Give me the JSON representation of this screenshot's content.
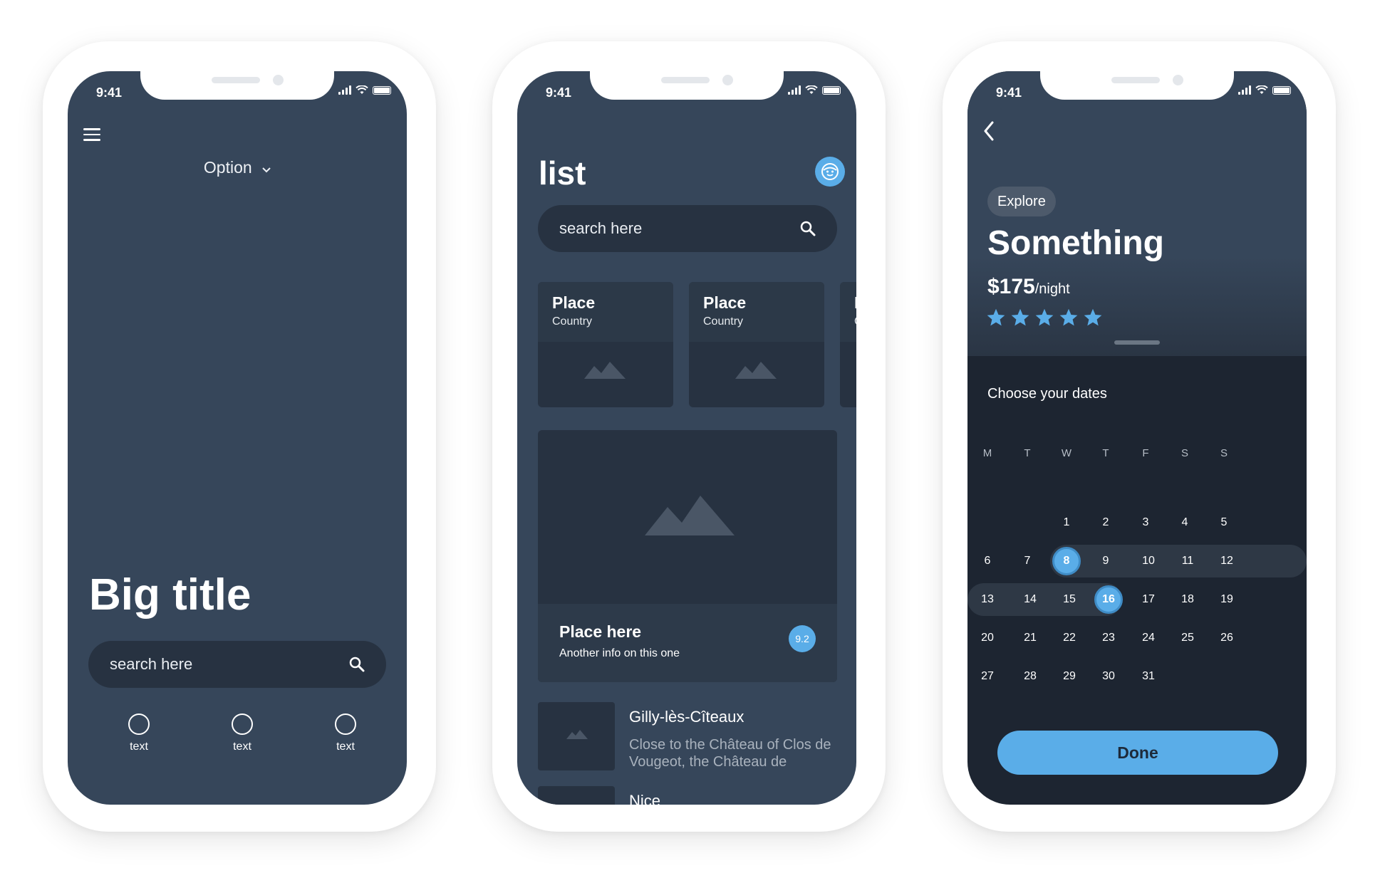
{
  "status": {
    "time": "9:41"
  },
  "screen1": {
    "option_label": "Option",
    "big_title": "Big title",
    "search_placeholder": "search here",
    "tabs": [
      {
        "label": "text"
      },
      {
        "label": "text"
      },
      {
        "label": "text"
      }
    ]
  },
  "screen2": {
    "title": "list",
    "search_placeholder": "search here",
    "cards": [
      {
        "title": "Place",
        "subtitle": "Country"
      },
      {
        "title": "Place",
        "subtitle": "Country"
      },
      {
        "title": "P",
        "subtitle": "C"
      }
    ],
    "featured": {
      "title": "Place here",
      "subtitle": "Another info on this one",
      "rating": "9.2"
    },
    "list": [
      {
        "title": "Gilly-lès-Cîteaux",
        "desc": "Close to the Château of Clos de Vougeot, the Château de"
      },
      {
        "title": "Nice",
        "desc": ""
      }
    ]
  },
  "screen3": {
    "tag": "Explore",
    "title": "Something",
    "price": "$175",
    "price_unit": "/night",
    "rating_stars": 5,
    "prompt": "Choose your dates",
    "weekdays": [
      "M",
      "T",
      "W",
      "T",
      "F",
      "S",
      "S"
    ],
    "days": [
      "1",
      "2",
      "3",
      "4",
      "5",
      "6",
      "7",
      "8",
      "9",
      "10",
      "11",
      "12",
      "13",
      "14",
      "15",
      "16",
      "17",
      "18",
      "19",
      "20",
      "21",
      "22",
      "23",
      "24",
      "25",
      "26",
      "27",
      "28",
      "29",
      "30",
      "31"
    ],
    "selected_start": "8",
    "selected_end": "16",
    "done_label": "Done"
  },
  "colors": {
    "accent": "#5aade8",
    "screen_bg": "#36465a",
    "dark_bg": "#1d2531"
  }
}
